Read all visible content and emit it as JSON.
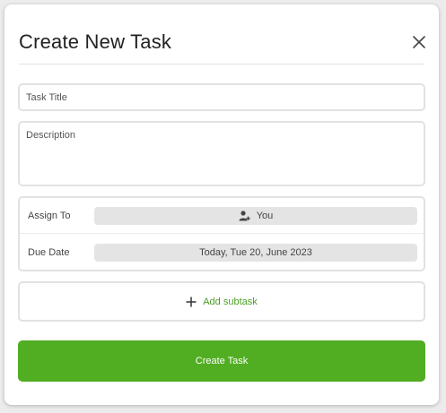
{
  "modal": {
    "title": "Create New Task"
  },
  "form": {
    "title_placeholder": "Task Title",
    "title_value": "",
    "description_placeholder": "Description",
    "description_value": ""
  },
  "meta": {
    "assign_label": "Assign To",
    "assign_value": "You",
    "due_label": "Due Date",
    "due_value": "Today, Tue 20, June 2023"
  },
  "subtask": {
    "label": "Add subtask"
  },
  "actions": {
    "create_label": "Create Task"
  },
  "colors": {
    "accent": "#51ad22",
    "accent_text": "#4a9e24",
    "pill_bg": "#e4e4e4",
    "border": "#e2e2e2"
  },
  "icons": {
    "close": "close-icon",
    "assign": "add-user-icon",
    "subtask": "plus-icon"
  }
}
